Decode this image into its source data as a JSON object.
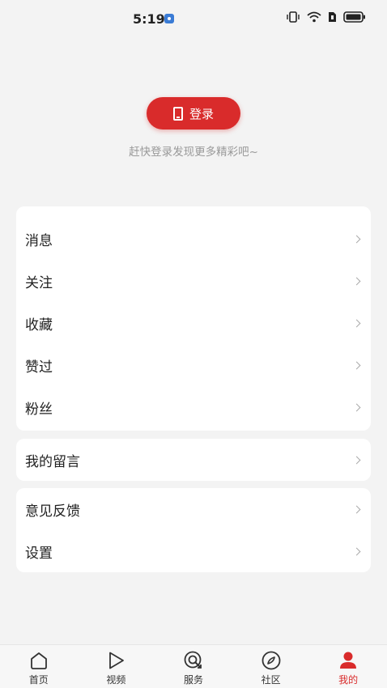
{
  "status": {
    "time": "5:19"
  },
  "login": {
    "button_label": "登录",
    "hint": "赶快登录发现更多精彩吧~"
  },
  "menu_group1": [
    {
      "label": "消息"
    },
    {
      "label": "关注"
    },
    {
      "label": "收藏"
    },
    {
      "label": "赞过"
    },
    {
      "label": "粉丝"
    }
  ],
  "menu_group2": [
    {
      "label": "我的留言"
    }
  ],
  "menu_group3": [
    {
      "label": "意见反馈"
    },
    {
      "label": "设置"
    }
  ],
  "tabs": [
    {
      "label": "首页",
      "icon": "home-icon"
    },
    {
      "label": "视频",
      "icon": "play-icon"
    },
    {
      "label": "服务",
      "icon": "service-icon"
    },
    {
      "label": "社区",
      "icon": "compass-icon"
    },
    {
      "label": "我的",
      "icon": "user-icon",
      "active": true
    }
  ],
  "colors": {
    "accent": "#d92b2b",
    "background": "#f3f3f3"
  }
}
